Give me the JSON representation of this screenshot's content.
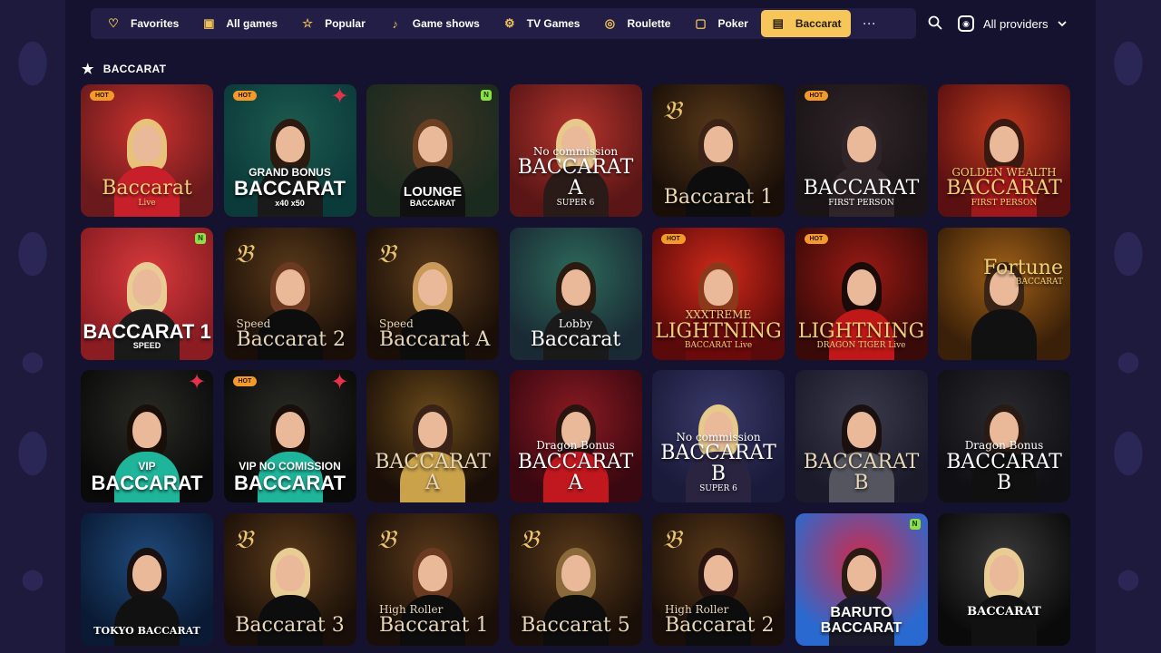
{
  "nav": {
    "tabs": [
      {
        "label": "Favorites",
        "icon": "heart-icon",
        "active": false
      },
      {
        "label": "All games",
        "icon": "all-games-icon",
        "active": false
      },
      {
        "label": "Popular",
        "icon": "star-badge-icon",
        "active": false
      },
      {
        "label": "Game shows",
        "icon": "microphone-icon",
        "active": false
      },
      {
        "label": "TV Games",
        "icon": "tv-games-icon",
        "active": false
      },
      {
        "label": "Roulette",
        "icon": "roulette-icon",
        "active": false
      },
      {
        "label": "Poker",
        "icon": "poker-icon",
        "active": false
      },
      {
        "label": "Baccarat",
        "icon": "baccarat-icon",
        "active": true
      }
    ],
    "more_label": "···",
    "providers_label": "All providers"
  },
  "section": {
    "title": "BACCARAT",
    "icon": "star-icon"
  },
  "games": [
    {
      "pre": "",
      "title": "Baccarat",
      "sub": "Live",
      "hot": true,
      "star": false,
      "prov": false,
      "logo_b": false,
      "style": "serif-gold",
      "bg1": "#6a1a1c",
      "bg2": "#c9322e",
      "hair": "#e8c27a",
      "body": "#c8202a"
    },
    {
      "pre": "GRAND BONUS",
      "title": "BACCARAT",
      "sub": "x40   x50",
      "hot": true,
      "star": true,
      "prov": false,
      "logo_b": false,
      "style": "bold-white",
      "bg1": "#0b3a3a",
      "bg2": "#1d5b4f",
      "hair": "#2a1a10",
      "body": "#1a1a1a"
    },
    {
      "pre": "",
      "title": "LOUNGE",
      "sub": "BACCARAT",
      "hot": false,
      "star": false,
      "prov": true,
      "logo_b": false,
      "style": "lounge",
      "bg1": "#1a2a1e",
      "bg2": "#3d3424",
      "hair": "#6b3f22",
      "body": "#111111"
    },
    {
      "pre": "No commission",
      "title": "BACCARAT A",
      "sub": "SUPER 6",
      "hot": false,
      "star": false,
      "prov": false,
      "logo_b": false,
      "style": "serif-white",
      "bg1": "#5a1616",
      "bg2": "#b5342c",
      "hair": "#e6c98b",
      "body": "#2a1a18"
    },
    {
      "pre": "",
      "title": "Baccarat 1",
      "sub": "",
      "hot": false,
      "star": false,
      "prov": false,
      "logo_b": true,
      "style": "serif-cream",
      "bg1": "#1a0f08",
      "bg2": "#5a3a1a",
      "hair": "#3a2216",
      "body": "#0d0d0d"
    },
    {
      "pre": "",
      "title": "BACCARAT",
      "sub": "FIRST PERSON",
      "hot": true,
      "star": false,
      "prov": false,
      "logo_b": false,
      "style": "serif-plain",
      "bg1": "#1a1416",
      "bg2": "#2f2528",
      "hair": "#2f2528",
      "body": "#2f2528"
    },
    {
      "pre": "GOLDEN WEALTH",
      "title": "BACCARAT",
      "sub": "FIRST PERSON",
      "hot": false,
      "star": false,
      "prov": false,
      "logo_b": false,
      "style": "serif-gold",
      "bg1": "#5a1010",
      "bg2": "#c0391f",
      "hair": "#3a1a10",
      "body": "#a0181a"
    },
    {
      "pre": "",
      "title": "BACCARAT 1",
      "sub": "SPEED",
      "hot": false,
      "star": false,
      "prov": true,
      "logo_b": false,
      "style": "bold-white",
      "bg1": "#8a1c22",
      "bg2": "#d83a3c",
      "hair": "#e8cc94",
      "body": "#1a1a1a"
    },
    {
      "pre": "Speed",
      "title": "Baccarat 2",
      "sub": "",
      "hot": false,
      "star": false,
      "prov": false,
      "logo_b": true,
      "style": "serif-cream-left",
      "bg1": "#1a0f08",
      "bg2": "#5a3a1a",
      "hair": "#6b3a20",
      "body": "#0d0d0d"
    },
    {
      "pre": "Speed",
      "title": "Baccarat A",
      "sub": "",
      "hot": false,
      "star": false,
      "prov": false,
      "logo_b": true,
      "style": "serif-cream-left",
      "bg1": "#1a0f08",
      "bg2": "#5a3a1a",
      "hair": "#c99a5a",
      "body": "#0d0d0d"
    },
    {
      "pre": "Lobby",
      "title": "Baccarat",
      "sub": "",
      "hot": false,
      "star": false,
      "prov": false,
      "logo_b": false,
      "style": "serif-white",
      "bg1": "#1a2a34",
      "bg2": "#2d6a5a",
      "hair": "#2a1a10",
      "body": "#1a1a1a"
    },
    {
      "pre": "XXXTREME",
      "title": "LIGHTNING",
      "sub": "BACCARAT Live",
      "hot": true,
      "star": false,
      "prov": false,
      "logo_b": false,
      "style": "serif-gold",
      "bg1": "#5a0a0a",
      "bg2": "#d02a1a",
      "hair": "#8a3a1a",
      "body": "#6a0a0a"
    },
    {
      "pre": "",
      "title": "LIGHTNING",
      "sub": "DRAGON TIGER Live",
      "hot": true,
      "star": false,
      "prov": false,
      "logo_b": false,
      "style": "serif-gold",
      "bg1": "#3a0a08",
      "bg2": "#9a1a14",
      "hair": "#1a0a08",
      "body": "#c01818"
    },
    {
      "pre": "",
      "title": "Fortune",
      "sub": "BACCARAT",
      "hot": false,
      "star": false,
      "prov": false,
      "logo_b": false,
      "style": "serif-gold-top",
      "bg1": "#3a2008",
      "bg2": "#a06018",
      "hair": "#3a2416",
      "body": "#111111"
    },
    {
      "pre": "VIP",
      "title": "BACCARAT",
      "sub": "",
      "hot": false,
      "star": true,
      "prov": false,
      "logo_b": false,
      "style": "bold-white",
      "bg1": "#0a0a0a",
      "bg2": "#2a2a24",
      "hair": "#1a0e08",
      "body": "#1fb59a"
    },
    {
      "pre": "VIP   NO COMISSION",
      "title": "BACCARAT",
      "sub": "",
      "hot": true,
      "star": true,
      "prov": false,
      "logo_b": false,
      "style": "bold-white",
      "bg1": "#0a0a0a",
      "bg2": "#2a2a24",
      "hair": "#1a0e08",
      "body": "#1fb59a"
    },
    {
      "pre": "",
      "title": "BACCARAT A",
      "sub": "",
      "hot": false,
      "star": false,
      "prov": false,
      "logo_b": false,
      "style": "serif-cream",
      "bg1": "#1a0f08",
      "bg2": "#6a4a1a",
      "hair": "#3a2216",
      "body": "#c9a24a"
    },
    {
      "pre": "Dragon Bonus",
      "title": "BACCARAT A",
      "sub": "",
      "hot": false,
      "star": false,
      "prov": false,
      "logo_b": false,
      "style": "serif-white",
      "bg1": "#3a0810",
      "bg2": "#8a1a22",
      "hair": "#2a1410",
      "body": "#c0181e"
    },
    {
      "pre": "No commission",
      "title": "BACCARAT B",
      "sub": "SUPER 6",
      "hot": false,
      "star": false,
      "prov": false,
      "logo_b": false,
      "style": "serif-white",
      "bg1": "#1a1a3a",
      "bg2": "#3a3a6a",
      "hair": "#e6c98b",
      "body": "#2a2440"
    },
    {
      "pre": "",
      "title": "BACCARAT B",
      "sub": "",
      "hot": false,
      "star": false,
      "prov": false,
      "logo_b": false,
      "style": "serif-cream",
      "bg1": "#1a1a2a",
      "bg2": "#3a3a4a",
      "hair": "#1a1010",
      "body": "#555560"
    },
    {
      "pre": "Dragon Bonus",
      "title": "BACCARAT B",
      "sub": "",
      "hot": false,
      "star": false,
      "prov": false,
      "logo_b": false,
      "style": "serif-white",
      "bg1": "#0f0f14",
      "bg2": "#2a2a2e",
      "hair": "#2a1a14",
      "body": "#101010"
    },
    {
      "pre": "",
      "title": "TOKYO BACCARAT",
      "sub": "",
      "hot": false,
      "star": false,
      "prov": false,
      "logo_b": false,
      "style": "tokyo",
      "bg1": "#0a1a34",
      "bg2": "#1f4a7a",
      "hair": "#1a1010",
      "body": "#111111"
    },
    {
      "pre": "",
      "title": "Baccarat 3",
      "sub": "",
      "hot": false,
      "star": false,
      "prov": false,
      "logo_b": true,
      "style": "serif-cream",
      "bg1": "#1a0f08",
      "bg2": "#5a3a1a",
      "hair": "#e8cc94",
      "body": "#0d0d0d"
    },
    {
      "pre": "High Roller",
      "title": "Baccarat 1",
      "sub": "",
      "hot": false,
      "star": false,
      "prov": false,
      "logo_b": true,
      "style": "serif-cream-left",
      "bg1": "#1a0f08",
      "bg2": "#5a3a1a",
      "hair": "#6b3a20",
      "body": "#0d0d0d"
    },
    {
      "pre": "",
      "title": "Baccarat 5",
      "sub": "",
      "hot": false,
      "star": false,
      "prov": false,
      "logo_b": true,
      "style": "serif-cream",
      "bg1": "#1a0f08",
      "bg2": "#5a3a1a",
      "hair": "#8a6a3a",
      "body": "#0d0d0d"
    },
    {
      "pre": "High Roller",
      "title": "Baccarat 2",
      "sub": "",
      "hot": false,
      "star": false,
      "prov": false,
      "logo_b": true,
      "style": "serif-cream-left",
      "bg1": "#1a0f08",
      "bg2": "#5a3a1a",
      "hair": "#2a1410",
      "body": "#0d0d0d"
    },
    {
      "pre": "",
      "title": "BARUTO BACCARAT",
      "sub": "",
      "hot": false,
      "star": false,
      "prov": true,
      "logo_b": false,
      "style": "bold-white-2",
      "bg1": "#2a6ad0",
      "bg2": "#d02a4a",
      "hair": "#2a1a14",
      "body": "#1a1a2a"
    },
    {
      "pre": "",
      "title": "BACCARAT",
      "sub": "",
      "hot": false,
      "star": false,
      "prov": false,
      "logo_b": false,
      "style": "framed",
      "bg1": "#0a0a0a",
      "bg2": "#3a3a3a",
      "hair": "#e8cc94",
      "body": "#111111"
    }
  ]
}
